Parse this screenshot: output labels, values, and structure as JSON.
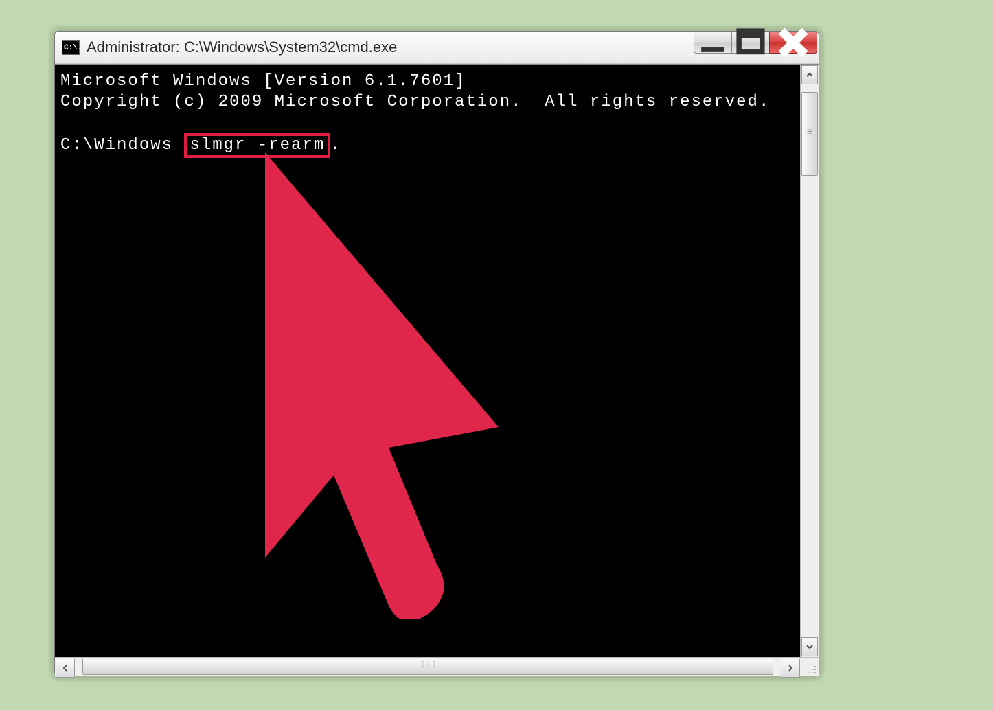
{
  "window": {
    "app_icon_text": "C:\\.",
    "title": "Administrator: C:\\Windows\\System32\\cmd.exe"
  },
  "console": {
    "line1": "Microsoft Windows [Version 6.1.7601]",
    "line2": "Copyright (c) 2009 Microsoft Corporation.  All rights reserved.",
    "prompt": "C:\\Windows ",
    "highlighted_command": "slmgr -rearm",
    "after_highlight": "."
  },
  "annotation": {
    "highlight_color": "#df1d3f",
    "cursor_color": "#e0274b"
  }
}
